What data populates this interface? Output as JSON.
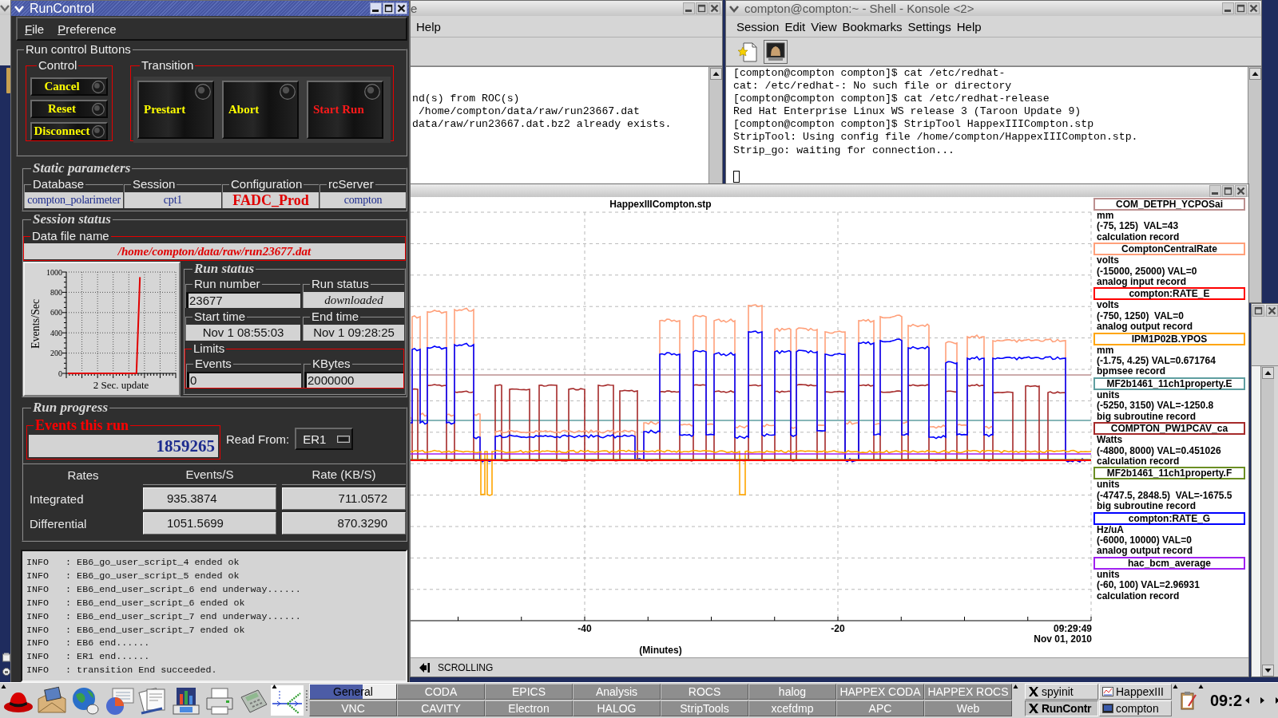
{
  "run_control": {
    "title": "RunControl",
    "menu": [
      "File",
      "Preference"
    ],
    "run_buttons": {
      "title": "Run control Buttons",
      "control": {
        "title": "Control",
        "buttons": [
          "Cancel",
          "Reset",
          "Disconnect"
        ]
      },
      "transition": {
        "title": "Transition",
        "buttons": [
          {
            "label": "Prestart",
            "highlighted": false
          },
          {
            "label": "Abort",
            "highlighted": false
          },
          {
            "label": "Start Run",
            "highlighted": true
          }
        ]
      }
    },
    "static_parameters": {
      "title": "Static parameters",
      "fields": [
        {
          "label": "Database",
          "value": "compton_polarimeter",
          "kind": "text"
        },
        {
          "label": "Session",
          "value": "cpt1",
          "kind": "text"
        },
        {
          "label": "Configuration",
          "value": "FADC_Prod",
          "kind": "emphasis"
        },
        {
          "label": "rcServer",
          "value": "compton",
          "kind": "text"
        }
      ]
    },
    "session_status": {
      "title": "Session status",
      "data_file": {
        "label": "Data file name",
        "value": "/home/compton/data/raw/run23677.dat"
      },
      "rate_plot": {
        "chart_data": {
          "type": "line",
          "ylabel": "Events/Sec",
          "xlabel": "2 Sec. update",
          "ylim": [
            0,
            1000
          ],
          "yticks": [
            0,
            200,
            400,
            600,
            800,
            1000
          ],
          "grid": true,
          "values": [
            0,
            0,
            0,
            0,
            0,
            0,
            0,
            0,
            0,
            0,
            0,
            0,
            0,
            0,
            0,
            0,
            0,
            0,
            0,
            0,
            0,
            0,
            0,
            0,
            0,
            0,
            0,
            0,
            0,
            0,
            0,
            0,
            0,
            0,
            0,
            0,
            0,
            0,
            0,
            0,
            470,
            950
          ]
        }
      },
      "run_status": {
        "title": "Run status",
        "fields": [
          {
            "label": "Run number",
            "value": "23677",
            "kind": "entry"
          },
          {
            "label": "Run status",
            "value": "downloaded",
            "kind": "state"
          },
          {
            "label": "Start time",
            "value": "Nov 1 08:55:03",
            "kind": "time"
          },
          {
            "label": "End time",
            "value": "Nov 1 09:28:25",
            "kind": "time"
          }
        ]
      },
      "limits": {
        "title": "Limits",
        "fields": [
          {
            "label": "Events",
            "value": "0"
          },
          {
            "label": "KBytes",
            "value": "2000000"
          }
        ]
      }
    },
    "run_progress": {
      "title": "Run progress",
      "events_this_run": {
        "label": "Events this run",
        "value": "1859265"
      },
      "read_from": {
        "label": "Read From:",
        "value": "ER1"
      },
      "rates": {
        "columns": [
          "Rates",
          "Events/S",
          "Rate (KB/S)"
        ],
        "rows": [
          {
            "label": "Integrated",
            "values": [
              "935.3874",
              "711.0572"
            ]
          },
          {
            "label": "Differential",
            "values": [
              "1051.5699",
              "870.3290"
            ]
          }
        ]
      }
    },
    "log": [
      "INFO   : EB6_go_user_script_4 ended ok",
      "INFO   : EB6_go_user_script_5 ended ok",
      "INFO   : EB6_end_user_script_6 end underway......",
      "INFO   : EB6_end_user_script_6 ended ok",
      "INFO   : EB6_end_user_script_7 end underway......",
      "INFO   : EB6_end_user_script_7 ended ok",
      "INFO   : EB6 end......",
      "INFO   : ER1 end......",
      "INFO   : transition End succeeded."
    ]
  },
  "terminal": {
    "title": "e",
    "menu": [
      "Help"
    ],
    "lines": [
      "nd(s) from ROC(s)",
      " /home/compton/data/raw/run23667.dat",
      "data/raw/run23667.dat.bz2 already exists."
    ]
  },
  "konsole": {
    "title": "compton@compton:~ - Shell - Konsole <2>",
    "menu": [
      "Session",
      "Edit",
      "View",
      "Bookmarks",
      "Settings",
      "Help"
    ],
    "lines": [
      "[compton@compton compton]$ cat /etc/redhat-",
      "cat: /etc/redhat-: No such file or directory",
      "[compton@compton compton]$ cat /etc/redhat-release",
      "Red Hat Enterprise Linux WS release 3 (Taroon Update 9)",
      "[compton@compton compton]$ StripTool HappexIIICompton.stp",
      "StripTool: Using config file /home/compton/HappexIIICompton.stp.",
      "Strip_go: waiting for connection..."
    ]
  },
  "strip_tool": {
    "plot_title": "HappexIIICompton.stp",
    "x_ticks": [
      "-40",
      "-20"
    ],
    "time_label": [
      "09:29:49",
      "Nov 01, 2010"
    ],
    "xlabel": "(Minutes)",
    "mode": "SCROLLING",
    "legend": [
      {
        "name": "COM_DETPH_YCPOSai",
        "color": "#bc8f8f",
        "units": "mm",
        "range": "(-75, 125)  VAL=43",
        "record": "calculation record"
      },
      {
        "name": "ComptonCentralRate",
        "color": "#ffa07a",
        "units": "volts",
        "range": "(-15000, 25000) VAL=0",
        "record": "analog input record"
      },
      {
        "name": "compton:RATE_E",
        "color": "#ff0000",
        "units": "volts",
        "range": "(-750, 1250)  VAL=0",
        "record": "analog output record"
      },
      {
        "name": "IPM1P02B.YPOS",
        "color": "#ffa500",
        "units": "mm",
        "range": "(-1.75, 4.25) VAL=0.671764",
        "record": "bpmsee record"
      },
      {
        "name": "MF2b1461_11ch1property.E",
        "color": "#5f9ea0",
        "units": "units",
        "range": "(-5250, 3150) VAL=-1250.8",
        "record": "big subroutine record"
      },
      {
        "name": "COMPTON_PW1PCAV_ca",
        "color": "#a52a2a",
        "units": "Watts",
        "range": "(-4800, 8000) VAL=0.451026",
        "record": "calculation record"
      },
      {
        "name": "MF2b1461_11ch1property.F",
        "color": "#6b8e23",
        "units": "units",
        "range": "(-4747.5, 2848.5)  VAL=-1675.5",
        "record": "big subroutine record"
      },
      {
        "name": "compton:RATE_G",
        "color": "#0000ff",
        "units": "Hz/uA",
        "range": "(-6000, 10000) VAL=0",
        "record": "analog output record"
      },
      {
        "name": "hac_bcm_average",
        "color": "#a020f0",
        "units": "units",
        "range": "(-60, 100) VAL=2.96931",
        "record": "calculation record"
      }
    ]
  },
  "panel": {
    "desktops": [
      {
        "label": "General",
        "selected": true
      },
      {
        "label": "CODA",
        "selected": false
      },
      {
        "label": "EPICS",
        "selected": false
      },
      {
        "label": "Analysis",
        "selected": false
      },
      {
        "label": "ROCS",
        "selected": false
      },
      {
        "label": "halog",
        "selected": false
      },
      {
        "label": "HAPPEX CODA",
        "selected": false
      },
      {
        "label": "HAPPEX ROCS",
        "selected": false
      },
      {
        "label": "VNC",
        "selected": false
      },
      {
        "label": "CAVITY",
        "selected": false
      },
      {
        "label": "Electron",
        "selected": false
      },
      {
        "label": "HALOG",
        "selected": false
      },
      {
        "label": "StripTools",
        "selected": false
      },
      {
        "label": "xcefdmp",
        "selected": false
      },
      {
        "label": "APC",
        "selected": false
      },
      {
        "label": "Web",
        "selected": false
      }
    ],
    "tasks": [
      {
        "label": "spyinit",
        "kind": "x",
        "selected": false
      },
      {
        "label": "HappexIII",
        "kind": "chart",
        "selected": false
      },
      {
        "label": "RunContr",
        "kind": "x",
        "selected": true
      },
      {
        "label": "compton",
        "kind": "shell",
        "selected": false
      }
    ],
    "clock": "09:2"
  }
}
